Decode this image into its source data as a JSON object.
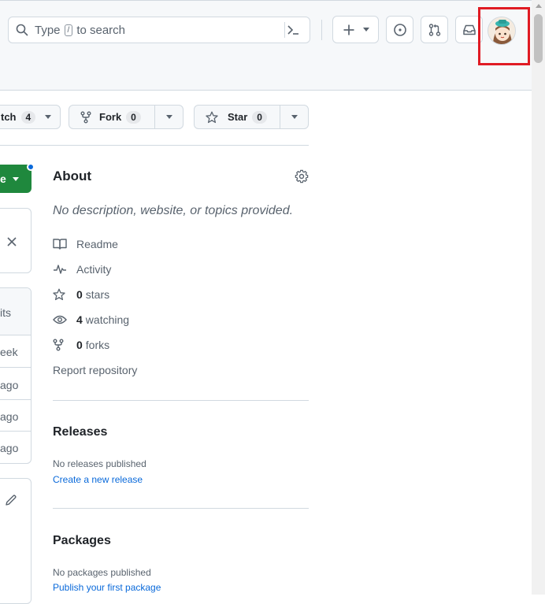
{
  "header": {
    "search_prefix": "Type",
    "search_key": "/",
    "search_suffix": "to search",
    "icons": [
      "search-icon",
      "command-palette-icon",
      "plus-icon",
      "chevron-down-icon",
      "issues-icon",
      "pull-requests-icon",
      "inbox-icon",
      "avatar"
    ]
  },
  "actions": {
    "watch_label": "tch",
    "watch_count": "4",
    "fork_label": "Fork",
    "fork_count": "0",
    "star_label": "Star",
    "star_count": "0"
  },
  "left": {
    "code_label": "e",
    "commits_label": "its",
    "rows": [
      "eek",
      "ago",
      "ago",
      "ago"
    ]
  },
  "about": {
    "title": "About",
    "description": "No description, website, or topics provided.",
    "readme": "Readme",
    "activity": "Activity",
    "stars_count": "0",
    "stars_label": "stars",
    "watching_count": "4",
    "watching_label": "watching",
    "forks_count": "0",
    "forks_label": "forks",
    "report": "Report repository"
  },
  "releases": {
    "title": "Releases",
    "empty": "No releases published",
    "link": "Create a new release"
  },
  "packages": {
    "title": "Packages",
    "empty": "No packages published",
    "link": "Publish your first package"
  },
  "colors": {
    "accent": "#0969da",
    "green": "#1f883d",
    "highlight": "#e01b24"
  }
}
